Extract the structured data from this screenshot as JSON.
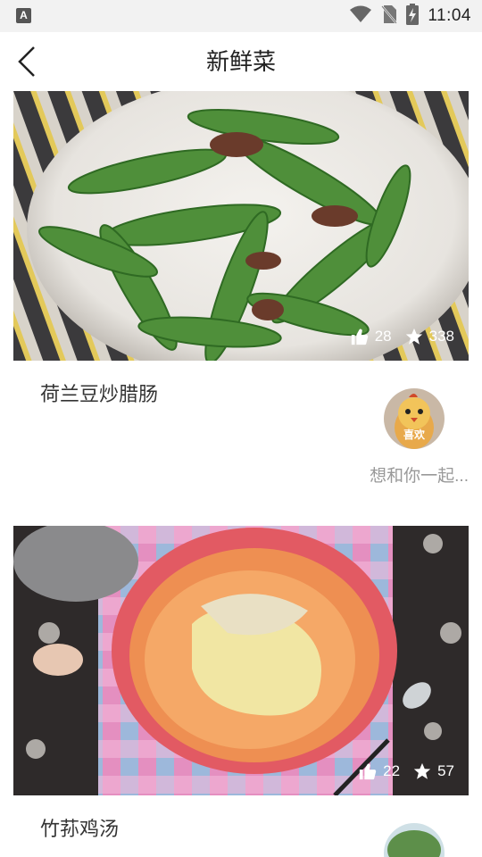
{
  "status_bar": {
    "time": "11:04",
    "app_indicator": "A",
    "icons": [
      "wifi-icon",
      "no-sim-icon",
      "battery-charging-icon"
    ]
  },
  "header": {
    "title": "新鲜菜",
    "back_icon": "chevron-left-icon"
  },
  "recipes": [
    {
      "title": "荷兰豆炒腊肠",
      "likes": "28",
      "favorites": "338",
      "avatar_badge": "喜欢",
      "author": "想和你一起..."
    },
    {
      "title": "竹荪鸡汤",
      "likes": "22",
      "favorites": "57"
    }
  ],
  "colors": {
    "status_bar_bg": "#f2f2f2",
    "title_text": "#222222",
    "muted_text": "#999999",
    "stat_text": "#ffffff"
  }
}
